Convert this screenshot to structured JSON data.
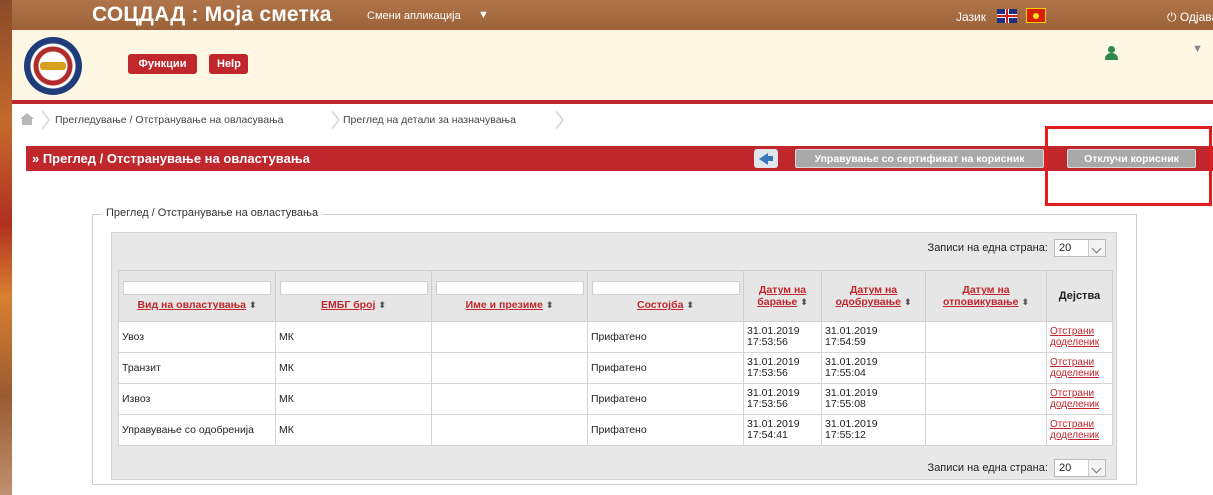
{
  "app": {
    "title": "СОЦДАД : Моја сметка",
    "switch_app": "Смени апликација",
    "switch_caret": "▼",
    "language_label": "Јазик",
    "logout": "⏻ Одјава"
  },
  "header": {
    "functions_button": "Функции",
    "help_button": "Help",
    "user_caret": "▼"
  },
  "breadcrumb": {
    "items": [
      "Прегледување / Отстранување на овласувања",
      "Преглед на детали за назначувања"
    ]
  },
  "titlebar": {
    "title": "» Преглед / Отстранување на овластувања",
    "certificate_button": "Управување со сертификат на корисник",
    "unlock_button": "Отклучи корисник"
  },
  "section": {
    "legend": "Преглед / Отстранување на овластувања"
  },
  "pager": {
    "label": "Записи на една страна:",
    "page_size": "20"
  },
  "grid": {
    "sort_marker": "⬍",
    "columns": {
      "type": "Вид на овластувања",
      "embg": "ЕМБГ број",
      "name": "Име и презиме",
      "status": "Состојба",
      "request_date": "Датум на барање",
      "approval_date": "Датум на одобрување",
      "revocation_date": "Датум на отповикување",
      "actions": "Дејства"
    },
    "rows": [
      {
        "type": "Увоз",
        "embg": "МК",
        "name": "",
        "status": "Прифатено",
        "request_date": "31.01.2019",
        "request_time": "17:53:56",
        "approval_date": "31.01.2019",
        "approval_time": "17:54:59",
        "revocation": "",
        "action": "Отстрани доделеник"
      },
      {
        "type": "Транзит",
        "embg": "МК",
        "name": "",
        "status": "Прифатено",
        "request_date": "31.01.2019",
        "request_time": "17:53:56",
        "approval_date": "31.01.2019",
        "approval_time": "17:55:04",
        "revocation": "",
        "action": "Отстрани доделеник"
      },
      {
        "type": "Извоз",
        "embg": "МК",
        "name": "",
        "status": "Прифатено",
        "request_date": "31.01.2019",
        "request_time": "17:53:56",
        "approval_date": "31.01.2019",
        "approval_time": "17:55:08",
        "revocation": "",
        "action": "Отстрани доделеник"
      },
      {
        "type": "Управување со одобренија",
        "embg": "МК",
        "name": "",
        "status": "Прифатено",
        "request_date": "31.01.2019",
        "request_time": "17:54:41",
        "approval_date": "31.01.2019",
        "approval_time": "17:55:12",
        "revocation": "",
        "action": "Отстрани доделеник"
      }
    ]
  },
  "colors": {
    "brand_red": "#c0272d",
    "topbar_brown": "#a66a40",
    "header_cream": "#fdf7e3",
    "highlight": "#e21d1d"
  },
  "icons": {
    "home": "home-icon",
    "back": "back-arrow-icon",
    "user": "user-icon",
    "flag_uk": "flag-uk-icon",
    "flag_mk": "flag-mk-icon",
    "logo": "customs-logo"
  }
}
